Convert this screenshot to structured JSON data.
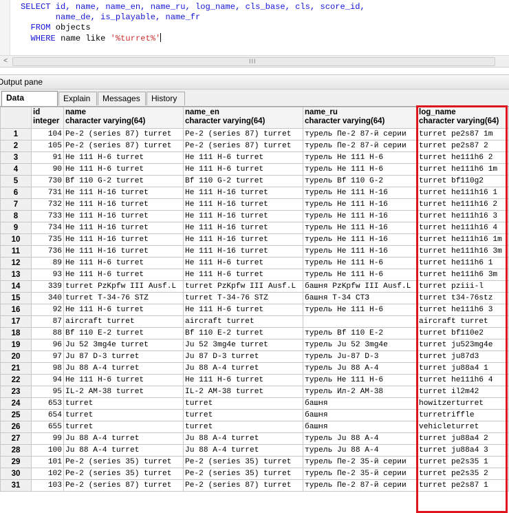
{
  "editor": {
    "sql_line1": "SELECT id, name, name_en, name_ru, log_name, cls_base, cls, score_id,",
    "sql_line2": "       name_de, is_playable, name_fr",
    "sql_line3_kw": "FROM",
    "sql_line3_rest": " objects",
    "sql_line4_kw": "WHERE",
    "sql_line4_mid": " name like ",
    "sql_line4_str": "'%turret%'"
  },
  "scrollbar": {
    "left_arrow": "<",
    "grip": "III"
  },
  "output_pane": {
    "title": "Output pane",
    "tabs": [
      "Data Output",
      "Explain",
      "Messages",
      "History"
    ],
    "active_tab": "Data Output"
  },
  "grid": {
    "columns": [
      {
        "name": "id",
        "type": "integer"
      },
      {
        "name": "name",
        "type": "character varying(64)"
      },
      {
        "name": "name_en",
        "type": "character varying(64)"
      },
      {
        "name": "name_ru",
        "type": "character varying(64)"
      },
      {
        "name": "log_name",
        "type": "character varying(64)"
      }
    ],
    "rows": [
      [
        "1",
        "104",
        "Pe-2 (series 87) turret",
        "Pe-2 (series 87) turret",
        "турель Пе-2 87-й серии",
        "turret pe2s87 1m"
      ],
      [
        "2",
        "105",
        "Pe-2 (series 87) turret",
        "Pe-2 (series 87) turret",
        "турель Пе-2 87-й серии",
        "turret pe2s87 2"
      ],
      [
        "3",
        "91",
        "He 111 H-6 turret",
        "He 111 H-6 turret",
        "турель He 111 H-6",
        "turret he111h6 2"
      ],
      [
        "4",
        "90",
        "He 111 H-6 turret",
        "He 111 H-6 turret",
        "турель He 111 H-6",
        "turret he111h6 1m"
      ],
      [
        "5",
        "730",
        "Bf 110 G-2 turret",
        "Bf 110 G-2 turret",
        "турель Bf 110 G-2",
        "turret bf110g2"
      ],
      [
        "6",
        "731",
        "He 111 H-16 turret",
        "He 111 H-16 turret",
        "турель He 111 H-16",
        "turret he111h16 1"
      ],
      [
        "7",
        "732",
        "He 111 H-16 turret",
        "He 111 H-16 turret",
        "турель He 111 H-16",
        "turret he111h16 2"
      ],
      [
        "8",
        "733",
        "He 111 H-16 turret",
        "He 111 H-16 turret",
        "турель He 111 H-16",
        "turret he111h16 3"
      ],
      [
        "9",
        "734",
        "He 111 H-16 turret",
        "He 111 H-16 turret",
        "турель He 111 H-16",
        "turret he111h16 4"
      ],
      [
        "10",
        "735",
        "He 111 H-16 turret",
        "He 111 H-16 turret",
        "турель He 111 H-16",
        "turret he111h16 1m"
      ],
      [
        "11",
        "736",
        "He 111 H-16 turret",
        "He 111 H-16 turret",
        "турель He 111 H-16",
        "turret he111h16 3m"
      ],
      [
        "12",
        "89",
        "He 111 H-6 turret",
        "He 111 H-6 turret",
        "турель He 111 H-6",
        "turret he111h6 1"
      ],
      [
        "13",
        "93",
        "He 111 H-6 turret",
        "He 111 H-6 turret",
        "турель He 111 H-6",
        "turret he111h6 3m"
      ],
      [
        "14",
        "339",
        "turret PzKpfw III Ausf.L",
        "turret PzKpfw III Ausf.L",
        "башня PzKpfw III Ausf.L",
        "turret pziii-l"
      ],
      [
        "15",
        "340",
        "turret T-34-76 STZ",
        "turret T-34-76 STZ",
        "башня Т-34 СТЗ",
        "turret t34-76stz"
      ],
      [
        "16",
        "92",
        "He 111 H-6 turret",
        "He 111 H-6 turret",
        "турель He 111 H-6",
        "turret he111h6 3"
      ],
      [
        "17",
        "87",
        "aircraft turret",
        "aircraft turret",
        "",
        "aircraft turret"
      ],
      [
        "18",
        "88",
        "Bf 110 E-2 turret",
        "Bf 110 E-2 turret",
        "турель Bf 110 E-2",
        "turret bf110e2"
      ],
      [
        "19",
        "96",
        "Ju 52 3mg4e turret",
        "Ju 52 3mg4e turret",
        "турель Ju 52 3mg4e",
        "turret ju523mg4e"
      ],
      [
        "20",
        "97",
        "Ju 87 D-3 turret",
        "Ju 87 D-3 turret",
        "турель Ju-87 D-3",
        "turret ju87d3"
      ],
      [
        "21",
        "98",
        "Ju 88 A-4 turret",
        "Ju 88 A-4 turret",
        "турель Ju 88 A-4",
        "turret ju88a4 1"
      ],
      [
        "22",
        "94",
        "He 111 H-6 turret",
        "He 111 H-6 turret",
        "турель He 111 H-6",
        "turret he111h6 4"
      ],
      [
        "23",
        "95",
        "IL-2 AM-38 turret",
        "IL-2 AM-38 turret",
        "турель Ил-2 АМ-38",
        "turret il2m42"
      ],
      [
        "24",
        "653",
        "turret",
        "turret",
        "башня",
        "howitzerturret"
      ],
      [
        "25",
        "654",
        "turret",
        "turret",
        "башня",
        "turretriffle"
      ],
      [
        "26",
        "655",
        "turret",
        "turret",
        "башня",
        "vehicleturret"
      ],
      [
        "27",
        "99",
        "Ju 88 A-4 turret",
        "Ju 88 A-4 turret",
        "турель Ju 88 A-4",
        "turret ju88a4 2"
      ],
      [
        "28",
        "100",
        "Ju 88 A-4 turret",
        "Ju 88 A-4 turret",
        "турель Ju 88 A-4",
        "turret ju88a4 3"
      ],
      [
        "29",
        "101",
        "Pe-2 (series 35) turret",
        "Pe-2 (series 35) turret",
        "турель Пе-2 35-й серии",
        "turret pe2s35 1"
      ],
      [
        "30",
        "102",
        "Pe-2 (series 35) turret",
        "Pe-2 (series 35) turret",
        "турель Пе-2 35-й серии",
        "turret pe2s35 2"
      ],
      [
        "31",
        "103",
        "Pe-2 (series 87) turret",
        "Pe-2 (series 87) turret",
        "турель Пе-2 87-й серии",
        "turret pe2s87 1"
      ]
    ]
  },
  "colors": {
    "highlight_border": "#e0161e",
    "sql_keyword": "#1515d8",
    "sql_string": "#d03030"
  }
}
